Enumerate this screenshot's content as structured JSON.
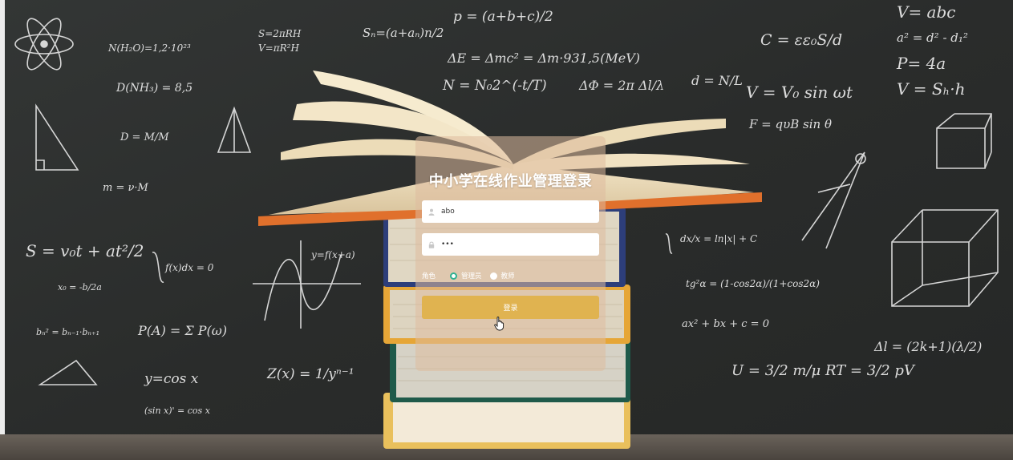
{
  "login": {
    "title": "中小学在线作业管理登录",
    "username_value": "abo",
    "password_value": "•••",
    "role_label": "角色",
    "roles": [
      {
        "label": "管理员",
        "checked": true
      },
      {
        "label": "教师",
        "checked": false
      }
    ],
    "submit_label": "登录"
  },
  "icons": {
    "username": "user-icon",
    "password": "lock-icon"
  },
  "colors": {
    "button": "#e0b350",
    "radio_checked": "#2fb191",
    "card": "rgba(222,188,158,0.55)"
  }
}
